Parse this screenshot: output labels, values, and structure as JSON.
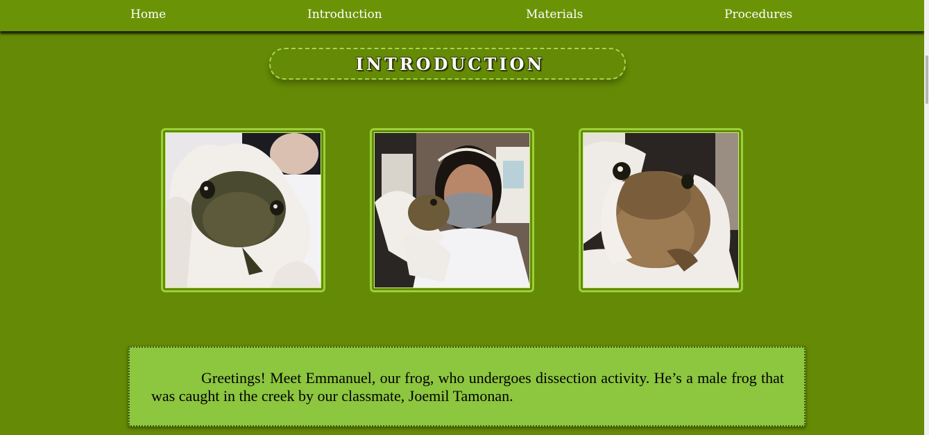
{
  "nav": {
    "items": [
      {
        "label": "Home"
      },
      {
        "label": "Introduction"
      },
      {
        "label": "Materials"
      },
      {
        "label": "Procedures"
      }
    ]
  },
  "section": {
    "title": "INTRODUCTION"
  },
  "gallery": {
    "photos": [
      {
        "subject": "gloved hand holding toad close-up"
      },
      {
        "subject": "student in mask holding toad"
      },
      {
        "subject": "toad held in gloved hands"
      }
    ]
  },
  "intro": {
    "text": "Greetings! Meet Emmanuel, our frog, who undergoes dissection activity. He’s a male frog that was caught in the creek by our classmate, Joemil Tamonan."
  },
  "colors": {
    "background": "#658a06",
    "navbar": "#6b9306",
    "accent_border": "#9ad13b",
    "intro_box": "#8dc63f"
  }
}
